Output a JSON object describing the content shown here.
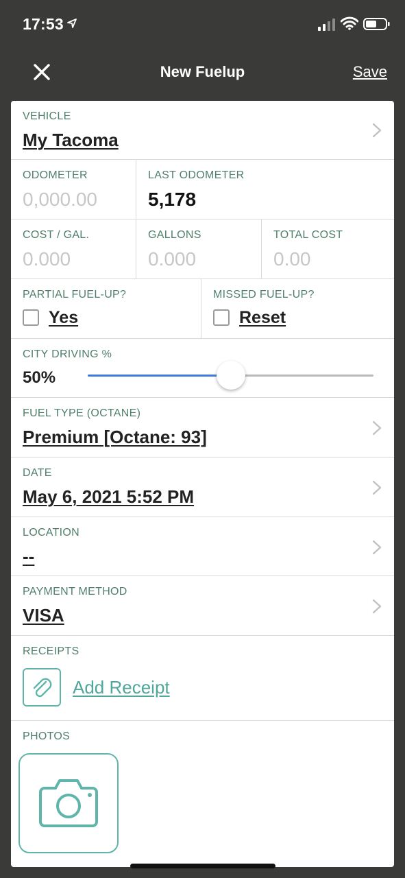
{
  "status": {
    "time": "17:53"
  },
  "nav": {
    "title": "New Fuelup",
    "save_label": "Save"
  },
  "vehicle": {
    "label": "VEHICLE",
    "value": "My Tacoma"
  },
  "odometer": {
    "label": "ODOMETER",
    "placeholder": "0,000.00"
  },
  "last_odometer": {
    "label": "LAST ODOMETER",
    "value": "5,178"
  },
  "cost_per_gal": {
    "label": "COST / GAL.",
    "placeholder": "0.000"
  },
  "gallons": {
    "label": "GALLONS",
    "placeholder": "0.000"
  },
  "total_cost": {
    "label": "TOTAL COST",
    "placeholder": "0.00"
  },
  "partial": {
    "label": "PARTIAL FUEL-UP?",
    "option": "Yes",
    "checked": false
  },
  "missed": {
    "label": "MISSED FUEL-UP?",
    "option": "Reset",
    "checked": false
  },
  "city_driving": {
    "label": "CITY DRIVING %",
    "value_text": "50%",
    "value": 50
  },
  "fuel_type": {
    "label": "FUEL TYPE (OCTANE)",
    "value": "Premium [Octane: 93]"
  },
  "date": {
    "label": "DATE",
    "value": "May 6, 2021 5:52 PM"
  },
  "location": {
    "label": "LOCATION",
    "value": "--"
  },
  "payment": {
    "label": "PAYMENT METHOD",
    "value": "VISA"
  },
  "receipts": {
    "label": "RECEIPTS",
    "add_label": "Add Receipt"
  },
  "photos": {
    "label": "PHOTOS"
  },
  "colors": {
    "accent_teal": "#5fb5aa",
    "label_green": "#4f7f6a",
    "slider_blue": "#3e7bd9",
    "header_bg": "#3a3a38"
  }
}
